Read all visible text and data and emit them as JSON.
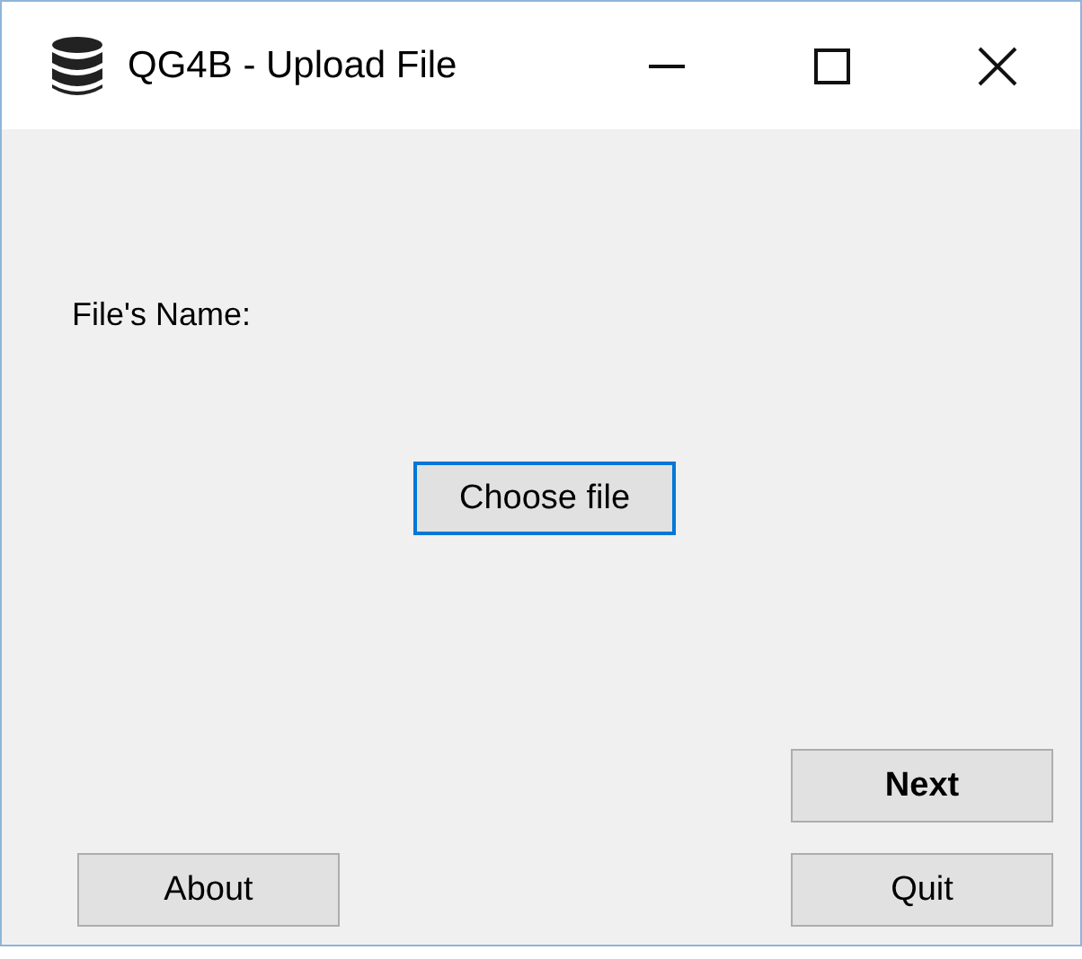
{
  "window": {
    "title": "QG4B - Upload File"
  },
  "label": "File's Name:",
  "choose_button": {
    "label": "Choose file",
    "focused": true
  },
  "left_buttons": [
    {
      "label": "About",
      "default": false
    }
  ],
  "right_buttons": [
    {
      "label": "Next",
      "default": true
    },
    {
      "label": "Quit",
      "default": false
    }
  ]
}
